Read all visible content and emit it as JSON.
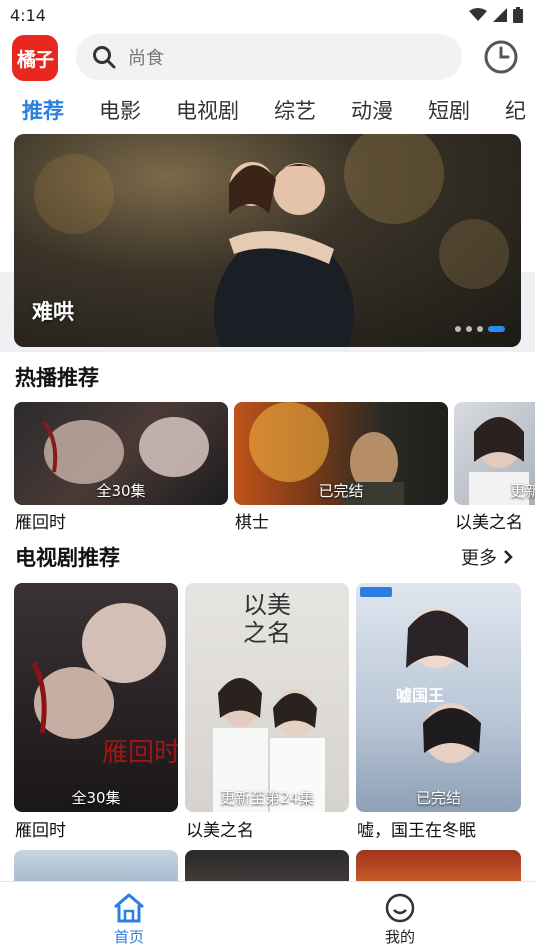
{
  "status_bar": {
    "time": "4:14"
  },
  "header": {
    "logo_text": "橘子",
    "search_placeholder": "尚食"
  },
  "tabs": [
    "推荐",
    "电影",
    "电视剧",
    "综艺",
    "动漫",
    "短剧",
    "纪"
  ],
  "banner": {
    "title": "难哄"
  },
  "hot": {
    "title": "热播推荐",
    "items": [
      {
        "name": "雁回时",
        "badge": "全30集"
      },
      {
        "name": "棋士",
        "badge": "已完结"
      },
      {
        "name": "以美之名",
        "badge": "更新"
      }
    ]
  },
  "tv": {
    "title": "电视剧推荐",
    "more_label": "更多",
    "items": [
      {
        "name": "雁回时",
        "badge": "全30集"
      },
      {
        "name": "以美之名",
        "badge": "更新至第24集"
      },
      {
        "name": "嘘，国王在冬眠",
        "badge": "已完结"
      }
    ]
  },
  "bottom_nav": {
    "home_label": "首页",
    "mine_label": "我的"
  },
  "colors": {
    "accent": "#2a7fe0",
    "logo_bg": "#e8271f"
  }
}
